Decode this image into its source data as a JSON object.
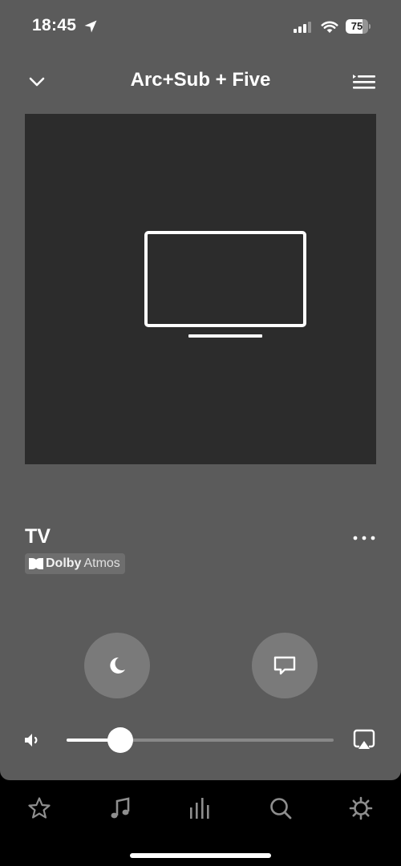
{
  "status_bar": {
    "time": "18:45",
    "battery_level": "75",
    "icons": [
      "location-arrow-icon",
      "cellular-signal-icon",
      "wifi-icon",
      "battery-icon"
    ]
  },
  "header": {
    "title": "Arc+Sub + Five",
    "left_icon": "chevron-down-icon",
    "right_icon": "queue-icon"
  },
  "artwork": {
    "icon": "tv-icon",
    "background": "#2c2c2c"
  },
  "now_playing": {
    "title": "TV",
    "badge": {
      "brand": "Dolby",
      "format": "Atmos"
    },
    "more_icon": "more-icon"
  },
  "controls": {
    "sleep_icon": "moon-icon",
    "speech_icon": "speech-bubble-icon"
  },
  "volume": {
    "level_percent": 20,
    "icon": "speaker-icon",
    "airplay_icon": "airplay-icon"
  },
  "tab_bar": {
    "items": [
      {
        "name": "favorites",
        "icon": "star-icon"
      },
      {
        "name": "music",
        "icon": "music-note-icon"
      },
      {
        "name": "system",
        "icon": "system-bars-icon"
      },
      {
        "name": "search",
        "icon": "search-icon"
      },
      {
        "name": "settings",
        "icon": "gear-icon"
      }
    ]
  },
  "colors": {
    "sheet": "#5b5b5b",
    "background": "#000000",
    "round_button": "#7a7a7a",
    "tab_icon": "#8e8e8e"
  }
}
